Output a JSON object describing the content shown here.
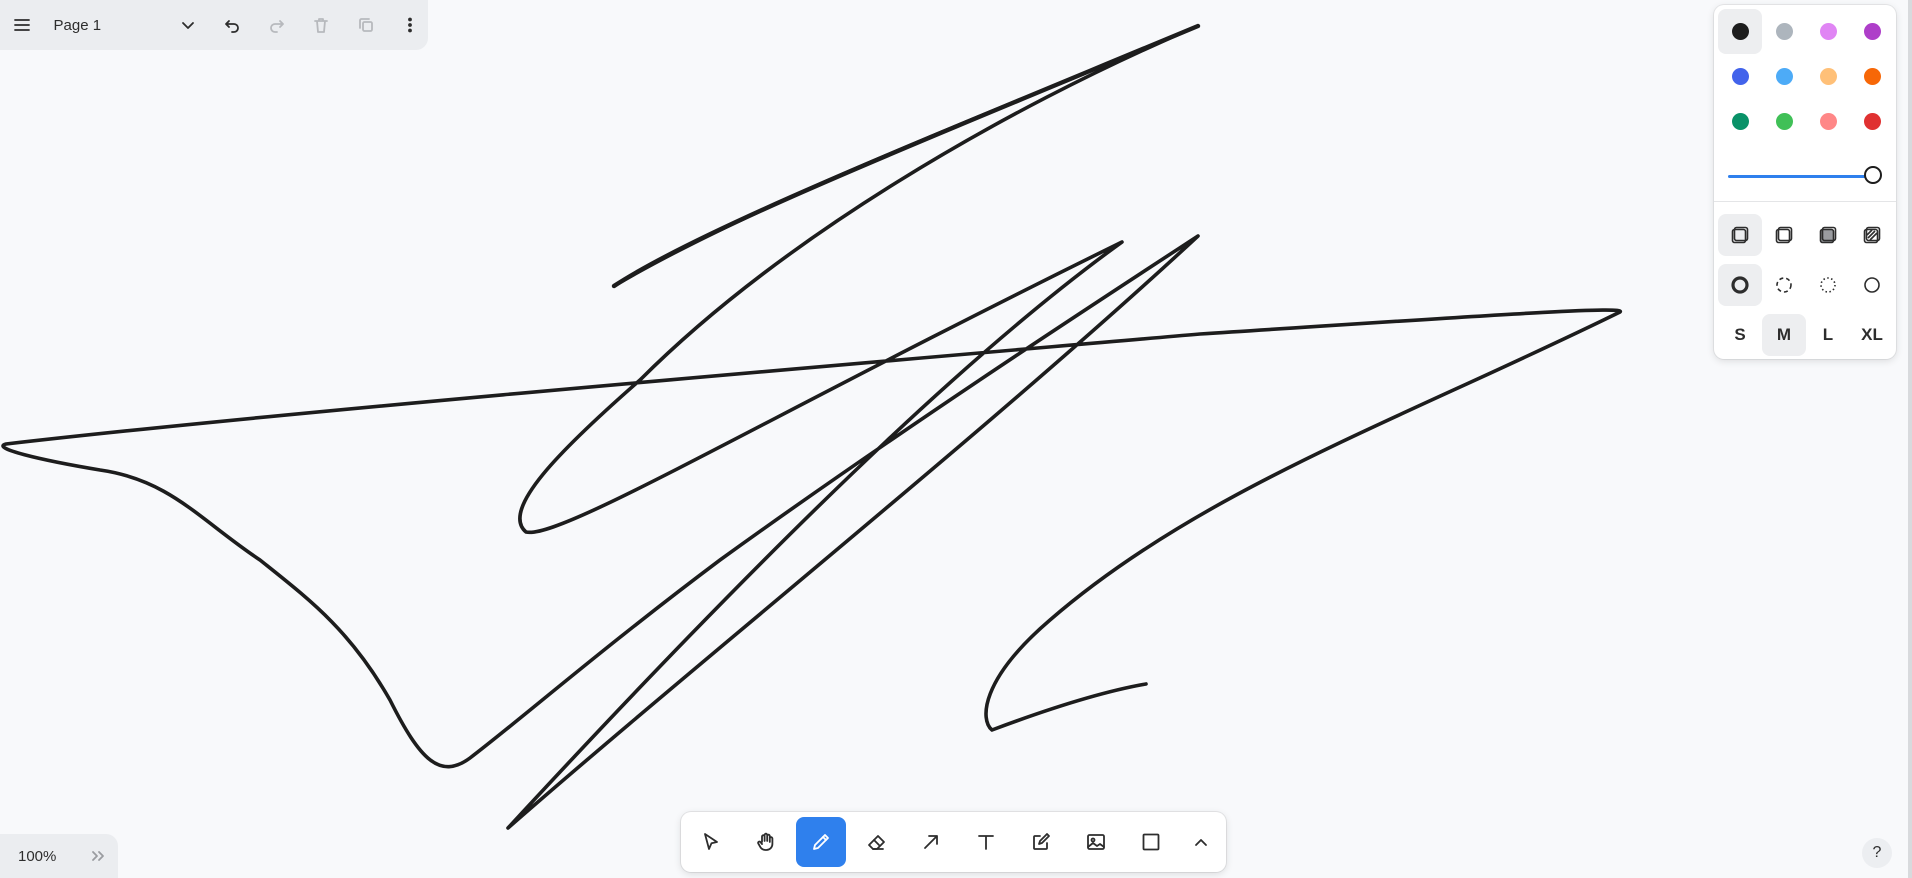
{
  "menu": {
    "page_name": "Page 1",
    "icons": [
      "menu-icon",
      "chevron-down-icon",
      "undo-icon",
      "redo-icon",
      "trash-icon",
      "duplicate-icon",
      "more-vertical-icon"
    ]
  },
  "style_panel": {
    "colors": [
      {
        "name": "black",
        "hex": "#1d1d1d",
        "selected": true
      },
      {
        "name": "grey",
        "hex": "#adb5bd",
        "selected": false
      },
      {
        "name": "light-violet",
        "hex": "#e085f4",
        "selected": false
      },
      {
        "name": "violet",
        "hex": "#ae3ec9",
        "selected": false
      },
      {
        "name": "blue",
        "hex": "#4263eb",
        "selected": false
      },
      {
        "name": "light-blue",
        "hex": "#4dabf7",
        "selected": false
      },
      {
        "name": "yellow",
        "hex": "#ffc078",
        "selected": false
      },
      {
        "name": "orange",
        "hex": "#f76707",
        "selected": false
      },
      {
        "name": "green",
        "hex": "#099268",
        "selected": false
      },
      {
        "name": "light-green",
        "hex": "#40c057",
        "selected": false
      },
      {
        "name": "light-red",
        "hex": "#ff8787",
        "selected": false
      },
      {
        "name": "red",
        "hex": "#e03131",
        "selected": false
      }
    ],
    "opacity": 1.0,
    "fill_icons": [
      "fill-none-icon",
      "fill-semi-icon",
      "fill-solid-icon",
      "fill-pattern-icon"
    ],
    "dash_icons": [
      "dash-draw-icon",
      "dash-dashed-icon",
      "dash-dotted-icon",
      "dash-solid-icon"
    ],
    "sizes": [
      "S",
      "M",
      "L",
      "XL"
    ],
    "selected_size": "M"
  },
  "toolbar": {
    "tools": [
      "select-icon",
      "hand-icon",
      "draw-icon",
      "eraser-icon",
      "arrow-icon",
      "text-icon",
      "note-icon",
      "image-icon",
      "rectangle-icon",
      "chevron-up-icon"
    ],
    "active_tool": "draw"
  },
  "zoom": {
    "label": "100%"
  },
  "help": {
    "label": "?"
  },
  "colors": {
    "accent": "#2f80ed",
    "canvas": "#f8f9fb",
    "ink": "#1d1d1d"
  }
}
